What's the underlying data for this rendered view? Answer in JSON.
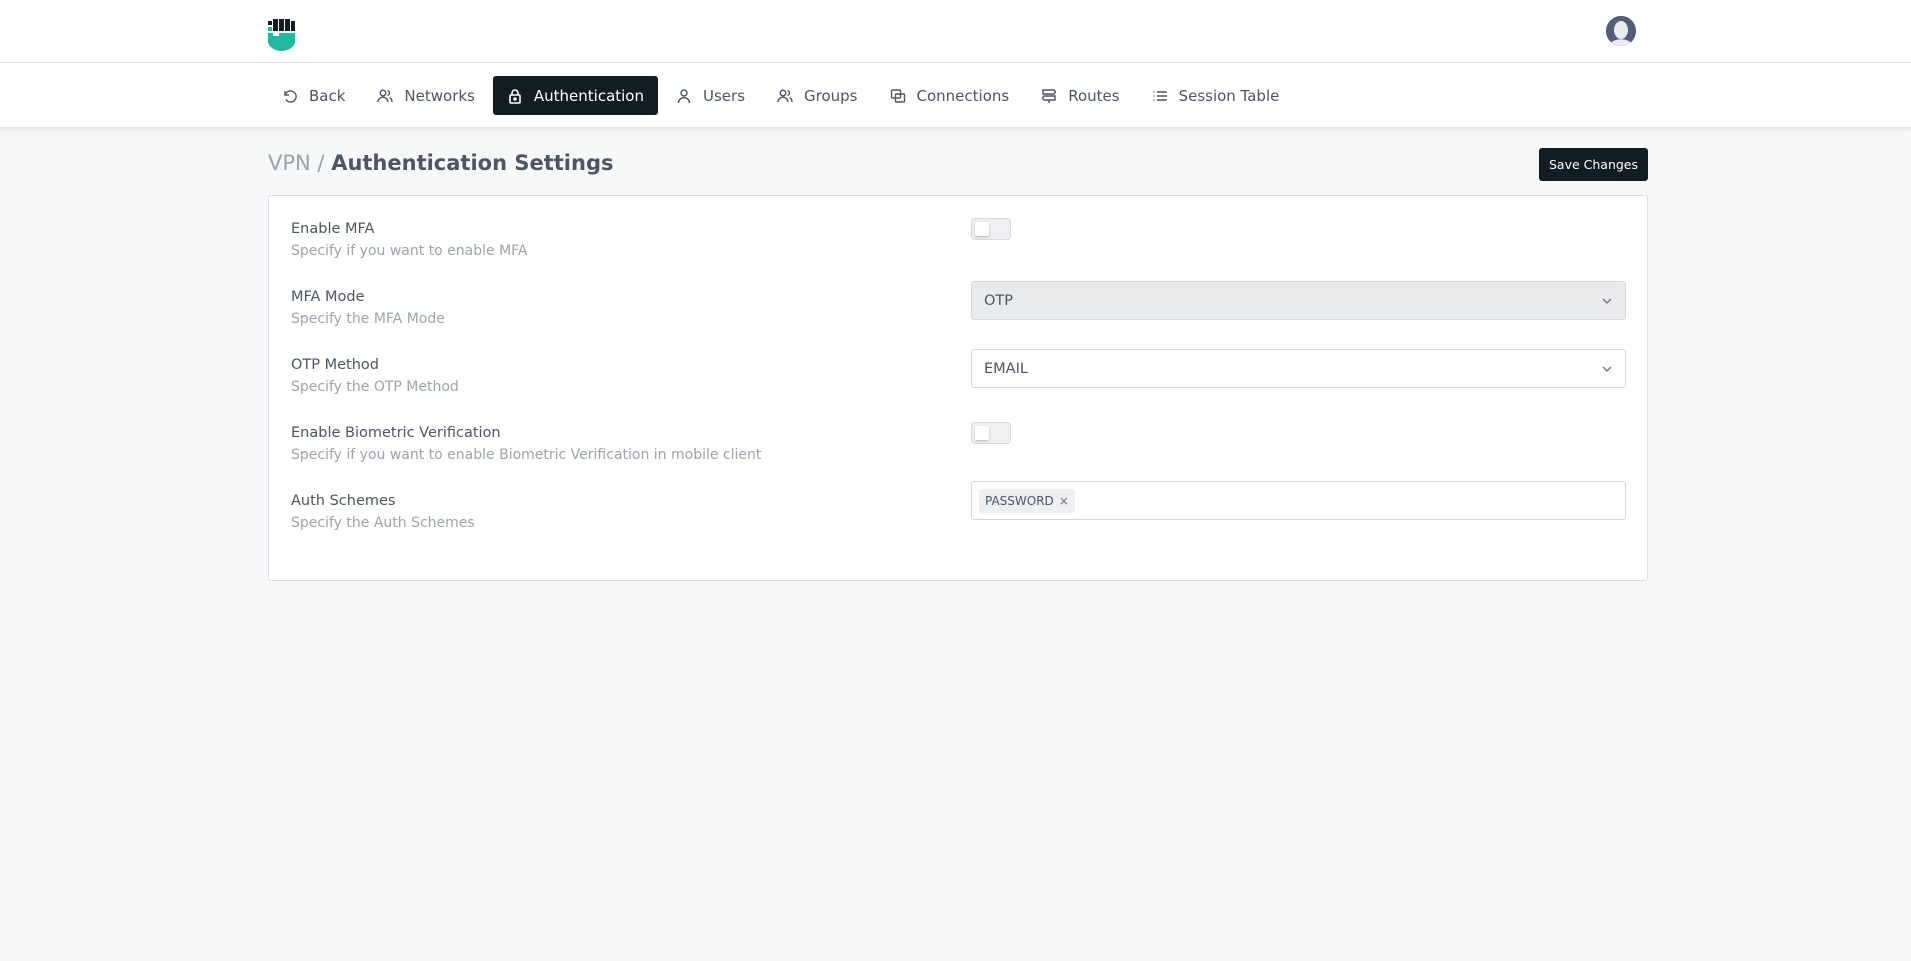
{
  "nav": {
    "items": [
      {
        "label": "Back",
        "icon": "undo-icon"
      },
      {
        "label": "Networks",
        "icon": "users-icon"
      },
      {
        "label": "Authentication",
        "icon": "lock-icon",
        "active": true
      },
      {
        "label": "Users",
        "icon": "user-icon"
      },
      {
        "label": "Groups",
        "icon": "users-icon"
      },
      {
        "label": "Connections",
        "icon": "connections-icon"
      },
      {
        "label": "Routes",
        "icon": "signpost-icon"
      },
      {
        "label": "Session Table",
        "icon": "list-icon"
      }
    ]
  },
  "header": {
    "breadcrumb": "VPN /",
    "title": "Authentication Settings",
    "save_label": "Save Changes"
  },
  "settings": {
    "enable_mfa": {
      "label": "Enable MFA",
      "desc": "Specify if you want to enable MFA",
      "enabled": false
    },
    "mfa_mode": {
      "label": "MFA Mode",
      "desc": "Specify the MFA Mode",
      "value": "OTP"
    },
    "otp_method": {
      "label": "OTP Method",
      "desc": "Specify the OTP Method",
      "value": "EMAIL"
    },
    "biometric": {
      "label": "Enable Biometric Verification",
      "desc": "Specify if you want to enable Biometric Verification in mobile client",
      "enabled": false
    },
    "auth_schemes": {
      "label": "Auth Schemes",
      "desc": "Specify the Auth Schemes",
      "tags": [
        "PASSWORD"
      ]
    }
  },
  "colors": {
    "brand": "#1fb8a0",
    "dark": "#111d22",
    "background": "#f7f8fa"
  }
}
